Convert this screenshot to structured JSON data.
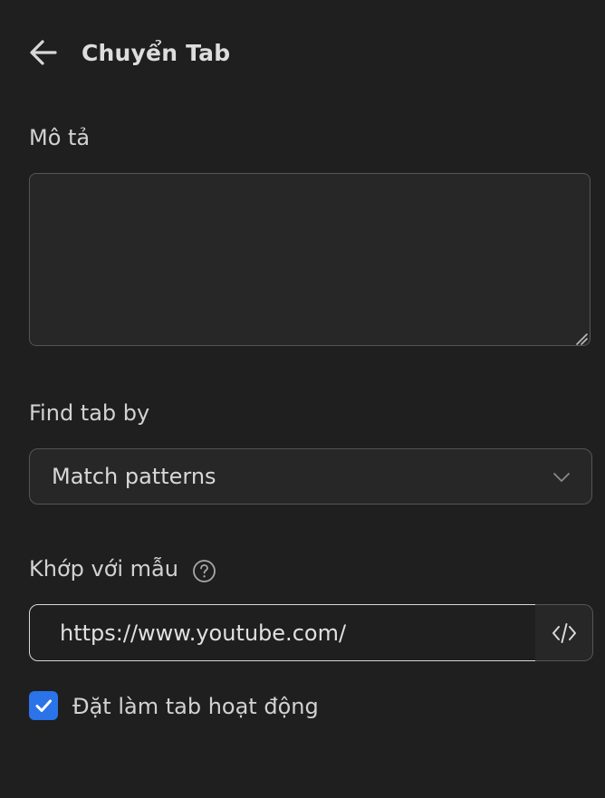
{
  "header": {
    "back_icon": "arrow-left-icon",
    "title": "Chuyển Tab"
  },
  "description": {
    "label": "Mô tả",
    "value": ""
  },
  "find_tab": {
    "label": "Find tab by",
    "selected": "Match patterns",
    "chevron_icon": "chevron-down-icon"
  },
  "match_pattern": {
    "label": "Khớp với mẫu",
    "help_icon": "help-circle-icon",
    "value": "https://www.youtube.com/",
    "code_icon": "code-icon"
  },
  "active_tab": {
    "label": "Đặt làm tab hoạt động",
    "checked": true,
    "accent": "#2a73e8"
  }
}
